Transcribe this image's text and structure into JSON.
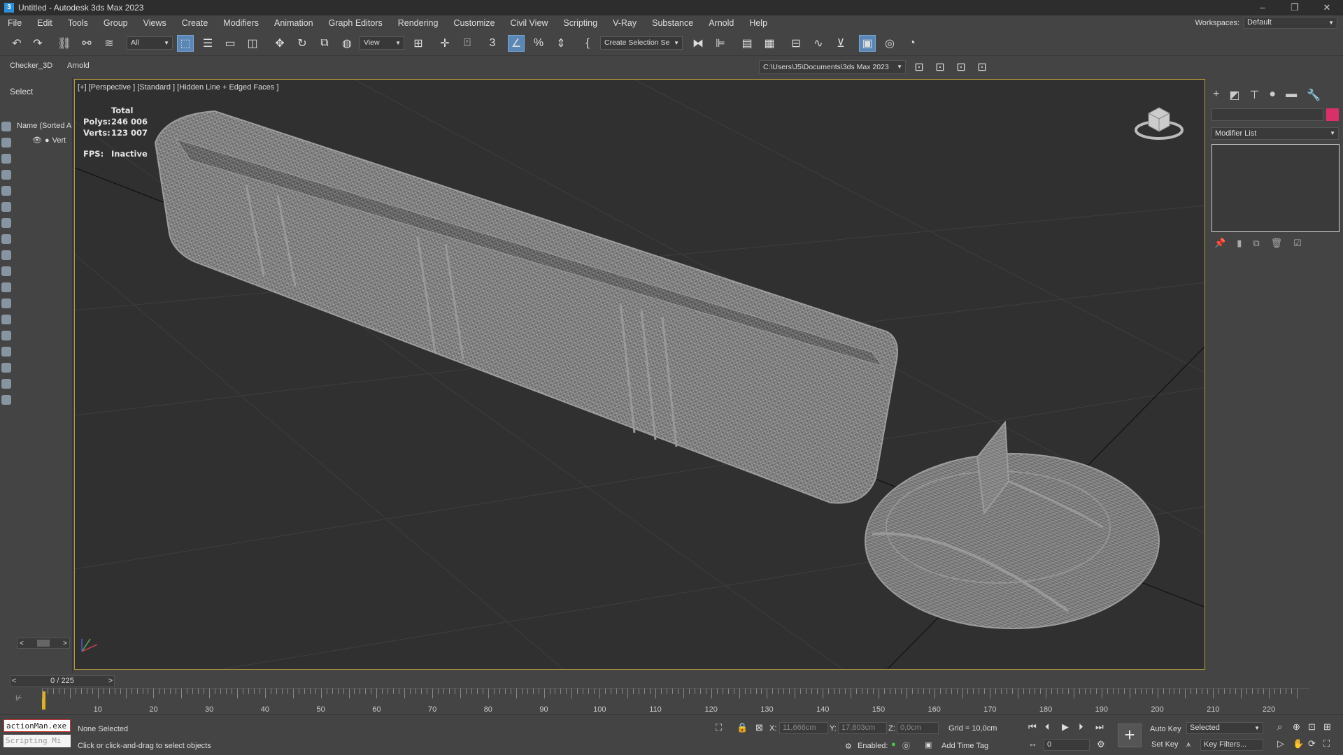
{
  "window": {
    "title": "Untitled - Autodesk 3ds Max 2023",
    "app_icon": "3",
    "min": "–",
    "max": "❐",
    "close": "✕"
  },
  "menu": [
    "File",
    "Edit",
    "Tools",
    "Group",
    "Views",
    "Create",
    "Modifiers",
    "Animation",
    "Graph Editors",
    "Rendering",
    "Customize",
    "Civil View",
    "Scripting",
    "V-Ray",
    "Substance",
    "Arnold",
    "Help"
  ],
  "workspace": {
    "label": "Workspaces:",
    "value": "Default"
  },
  "toolbar": {
    "filter_value": "All",
    "view_value": "View",
    "selection_set": "Create Selection Se",
    "snap_label": "3",
    "percent_label": "%"
  },
  "ribbon": {
    "tab1": "Checker_3D",
    "tab2": "Arnold",
    "project_path": "C:\\Users\\J5\\Documents\\3ds Max 2023"
  },
  "scene_explorer": {
    "select_tab": "Select",
    "header": "Name (Sorted A",
    "row": "Vert"
  },
  "viewport": {
    "label": "[+] [Perspective ] [Standard ] [Hidden Line + Edged Faces ]",
    "stats": {
      "total": "Total",
      "polys_label": "Polys:",
      "polys": "246 006",
      "verts_label": "Verts:",
      "verts": "123 007",
      "fps_label": "FPS:",
      "fps": "Inactive"
    }
  },
  "command_panel": {
    "modifier_list": "Modifier List",
    "color": "#d9306a"
  },
  "timeline": {
    "frame": "0 / 225",
    "labels": [
      "10",
      "20",
      "30",
      "40",
      "50",
      "60",
      "70",
      "80",
      "90",
      "100",
      "110",
      "120",
      "130",
      "140",
      "150",
      "160",
      "170",
      "180",
      "190",
      "200",
      "210",
      "220"
    ]
  },
  "status": {
    "script_line1": "actionMan.exe",
    "script_line2": "Scripting Mi",
    "selection": "None Selected",
    "prompt": "Click or click-and-drag to select objects",
    "x_label": "X:",
    "x_value": "11,666cm",
    "y_label": "Y:",
    "y_value": "17,803cm",
    "z_label": "Z:",
    "z_value": "0,0cm",
    "grid": "Grid = 10,0cm",
    "enabled": "Enabled:",
    "add_time_tag": "Add Time Tag",
    "auto_key": "Auto Key",
    "set_key": "Set Key",
    "selected": "Selected",
    "key_filters": "Key Filters...",
    "frame_field": "0"
  }
}
